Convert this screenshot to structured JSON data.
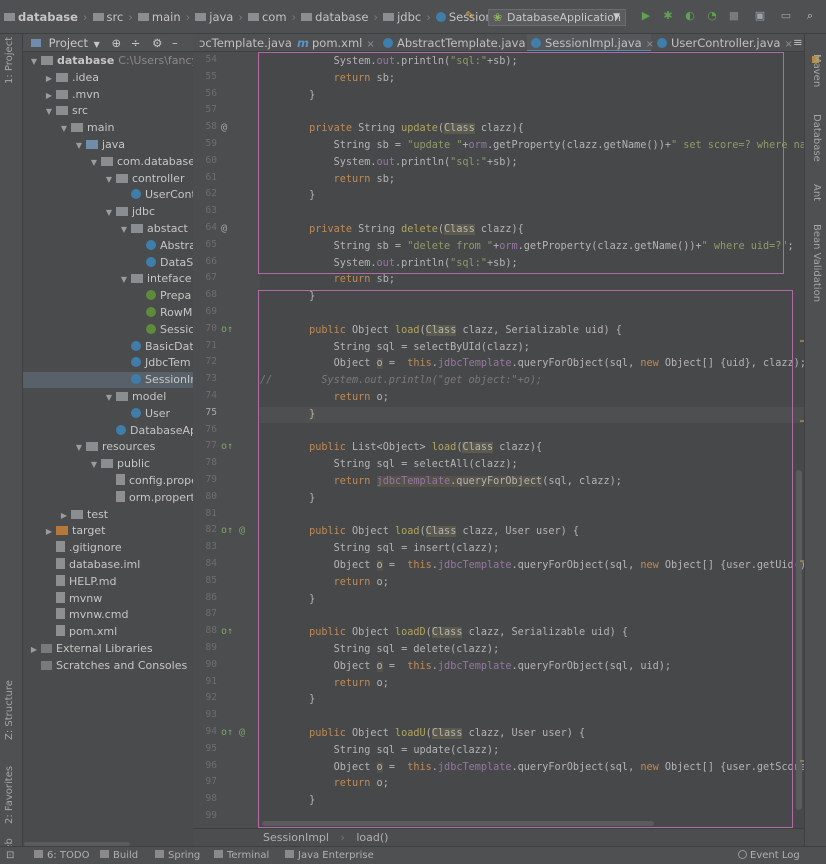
{
  "breadcrumb": [
    {
      "label": "database",
      "icon": "folder-icon"
    },
    {
      "label": "src",
      "icon": "folder-icon"
    },
    {
      "label": "main",
      "icon": "folder-icon"
    },
    {
      "label": "java",
      "icon": "folder-icon"
    },
    {
      "label": "com",
      "icon": "folder-icon"
    },
    {
      "label": "database",
      "icon": "folder-icon"
    },
    {
      "label": "jdbc",
      "icon": "folder-icon"
    },
    {
      "label": "SessionImpl",
      "icon": "class-icon"
    }
  ],
  "run_config": {
    "label": "DatabaseApplication"
  },
  "project_panel": {
    "title": "Project"
  },
  "tree": [
    {
      "label": "database",
      "detail": "C:\\Users\\fancy55\\",
      "depth": 0,
      "arrow": "▼",
      "icon": "folder",
      "bold": true
    },
    {
      "label": ".idea",
      "depth": 1,
      "arrow": "▶",
      "icon": "folder"
    },
    {
      "label": ".mvn",
      "depth": 1,
      "arrow": "▶",
      "icon": "folder"
    },
    {
      "label": "src",
      "depth": 1,
      "arrow": "▼",
      "icon": "folder"
    },
    {
      "label": "main",
      "depth": 2,
      "arrow": "▼",
      "icon": "folder"
    },
    {
      "label": "java",
      "depth": 3,
      "arrow": "▼",
      "icon": "folder-blue"
    },
    {
      "label": "com.database",
      "depth": 4,
      "arrow": "▼",
      "icon": "folder"
    },
    {
      "label": "controller",
      "depth": 5,
      "arrow": "▼",
      "icon": "folder"
    },
    {
      "label": "UserCont",
      "depth": 6,
      "arrow": "",
      "icon": "class"
    },
    {
      "label": "jdbc",
      "depth": 5,
      "arrow": "▼",
      "icon": "folder"
    },
    {
      "label": "abstact",
      "depth": 6,
      "arrow": "▼",
      "icon": "folder"
    },
    {
      "label": "Abstra",
      "depth": 7,
      "arrow": "",
      "icon": "class"
    },
    {
      "label": "DataS",
      "depth": 7,
      "arrow": "",
      "icon": "class"
    },
    {
      "label": "inteface",
      "depth": 6,
      "arrow": "▼",
      "icon": "folder"
    },
    {
      "label": "Prepa",
      "depth": 7,
      "arrow": "",
      "icon": "iface"
    },
    {
      "label": "RowM",
      "depth": 7,
      "arrow": "",
      "icon": "iface"
    },
    {
      "label": "Sessic",
      "depth": 7,
      "arrow": "",
      "icon": "iface"
    },
    {
      "label": "BasicData",
      "depth": 6,
      "arrow": "",
      "icon": "class"
    },
    {
      "label": "JdbcTem",
      "depth": 6,
      "arrow": "",
      "icon": "class"
    },
    {
      "label": "SessionIr",
      "depth": 6,
      "arrow": "",
      "icon": "class",
      "selected": true
    },
    {
      "label": "model",
      "depth": 5,
      "arrow": "▼",
      "icon": "folder"
    },
    {
      "label": "User",
      "depth": 6,
      "arrow": "",
      "icon": "class"
    },
    {
      "label": "DatabaseAp",
      "depth": 5,
      "arrow": "",
      "icon": "class"
    },
    {
      "label": "resources",
      "depth": 3,
      "arrow": "▼",
      "icon": "folder"
    },
    {
      "label": "public",
      "depth": 4,
      "arrow": "▼",
      "icon": "folder"
    },
    {
      "label": "config.prope",
      "depth": 5,
      "arrow": "",
      "icon": "file"
    },
    {
      "label": "orm.propert",
      "depth": 5,
      "arrow": "",
      "icon": "file"
    },
    {
      "label": "test",
      "depth": 2,
      "arrow": "▶",
      "icon": "folder"
    },
    {
      "label": "target",
      "depth": 1,
      "arrow": "▶",
      "icon": "folder-orange"
    },
    {
      "label": ".gitignore",
      "depth": 1,
      "arrow": "",
      "icon": "file"
    },
    {
      "label": "database.iml",
      "depth": 1,
      "arrow": "",
      "icon": "file"
    },
    {
      "label": "HELP.md",
      "depth": 1,
      "arrow": "",
      "icon": "file"
    },
    {
      "label": "mvnw",
      "depth": 1,
      "arrow": "",
      "icon": "file"
    },
    {
      "label": "mvnw.cmd",
      "depth": 1,
      "arrow": "",
      "icon": "file"
    },
    {
      "label": "pom.xml",
      "depth": 1,
      "arrow": "",
      "icon": "file"
    },
    {
      "label": "External Libraries",
      "depth": 0,
      "arrow": "▶",
      "icon": "lib"
    },
    {
      "label": "Scratches and Consoles",
      "depth": 0,
      "arrow": "",
      "icon": "lib"
    }
  ],
  "tabs": [
    {
      "label": "ɔcTemplate.java",
      "icon": "class",
      "active": false
    },
    {
      "label": "pom.xml",
      "icon": "maven",
      "active": false
    },
    {
      "label": "AbstractTemplate.java",
      "icon": "class",
      "active": false
    },
    {
      "label": "SessionImpl.java",
      "icon": "class",
      "active": true
    },
    {
      "label": "UserController.java",
      "icon": "class",
      "active": false
    }
  ],
  "code": [
    {
      "n": "54",
      "h": "            System.<f>out</f>.println(<s>\"sql:\"</s>+sb);"
    },
    {
      "n": "55",
      "h": "            <k>return</k> sb;"
    },
    {
      "n": "56",
      "h": "        }"
    },
    {
      "n": "57",
      "h": ""
    },
    {
      "n": "58",
      "mark": "@",
      "h": "        <k>private</k> String <y>update</y>(<cls>Class</cls> clazz){"
    },
    {
      "n": "59",
      "h": "            String sb = <s>\"update \"</s>+<f>orm</f>.getProperty(clazz.getName())+<s>\" set score=? where name=?\"</s>;"
    },
    {
      "n": "60",
      "h": "            System.<f>out</f>.println(<s>\"sql:\"</s>+sb);"
    },
    {
      "n": "61",
      "h": "            <k>return</k> sb;"
    },
    {
      "n": "62",
      "h": "        }"
    },
    {
      "n": "63",
      "h": ""
    },
    {
      "n": "64",
      "mark": "@",
      "h": "        <k>private</k> String <y>delete</y>(<cls>Class</cls> clazz){"
    },
    {
      "n": "65",
      "h": "            String sb = <s>\"delete from \"</s>+<f>orm</f>.getProperty(clazz.getName())+<s>\" where uid=?\"</s>;"
    },
    {
      "n": "66",
      "h": "            System.<f>out</f>.println(<s>\"sql:\"</s>+sb);"
    },
    {
      "n": "67",
      "h": "            <k>return</k> sb;"
    },
    {
      "n": "68",
      "h": "        }"
    },
    {
      "n": "69",
      "h": ""
    },
    {
      "n": "70",
      "mark": "o↑",
      "h": "        <k>public</k> Object <y>load</y>(<cls>Class</cls> clazz, Serializable uid) {"
    },
    {
      "n": "71",
      "h": "            String sql = selectByUId(clazz);"
    },
    {
      "n": "72",
      "h": "            Object <sb>o</sb> =  <k>this</k>.<f>jdbcTemplate</f>.queryForObject(sql, <k>new</k> Object[] {uid}, clazz);"
    },
    {
      "n": "73",
      "h": "<c>//        System.out.println(\"get object:\"+o);</c>"
    },
    {
      "n": "74",
      "h": "            <k>return</k> o;"
    },
    {
      "n": "75",
      "cur": true,
      "h": "        <sb>}</sb>"
    },
    {
      "n": "76",
      "h": ""
    },
    {
      "n": "77",
      "mark": "o↑",
      "h": "        <k>public</k> List&lt;Object&gt; <y>load</y>(<cls>Class</cls> clazz){"
    },
    {
      "n": "78",
      "h": "            String sql = selectAll(clazz);"
    },
    {
      "n": "79",
      "h": "            <k>return</k> <sb><f>jdbcTemplate</f></sb><sb>.queryForObject</sb>(sql, clazz);"
    },
    {
      "n": "80",
      "h": "        }"
    },
    {
      "n": "81",
      "h": ""
    },
    {
      "n": "82",
      "mark": "o↑ @",
      "h": "        <k>public</k> Object <y>load</y>(<cls>Class</cls> clazz, User user) {"
    },
    {
      "n": "83",
      "h": "            String sql = insert(clazz);"
    },
    {
      "n": "84",
      "h": "            Object <sb>o</sb> =  <k>this</k>.<f>jdbcTemplate</f>.queryForObject(sql, <k>new</k> Object[] {user.getUid(),user.ge"
    },
    {
      "n": "85",
      "h": "            <k>return</k> o;"
    },
    {
      "n": "86",
      "h": "        }"
    },
    {
      "n": "87",
      "h": ""
    },
    {
      "n": "88",
      "mark": "o↑",
      "h": "        <k>public</k> Object <y>loadD</y>(<cls>Class</cls> clazz, Serializable uid) {"
    },
    {
      "n": "89",
      "h": "            String sql = delete(clazz);"
    },
    {
      "n": "90",
      "h": "            Object <sb>o</sb> =  <k>this</k>.<f>jdbcTemplate</f>.queryForObject(sql, uid);"
    },
    {
      "n": "91",
      "h": "            <k>return</k> o;"
    },
    {
      "n": "92",
      "h": "        }"
    },
    {
      "n": "93",
      "h": ""
    },
    {
      "n": "94",
      "mark": "o↑ @",
      "h": "        <k>public</k> Object <y>loadU</y>(<cls>Class</cls> clazz, User user) {"
    },
    {
      "n": "95",
      "h": "            String sql = update(clazz);"
    },
    {
      "n": "96",
      "h": "            Object <sb>o</sb> =  <k>this</k>.<f>jdbcTemplate</f>.queryForObject(sql, <k>new</k> Object[] {user.getScore(), user"
    },
    {
      "n": "97",
      "h": "            <k>return</k> o;"
    },
    {
      "n": "98",
      "h": "        }"
    },
    {
      "n": "99",
      "h": ""
    }
  ],
  "editor_breadcrumb": {
    "class_name": "SessionImpl",
    "separator": "›",
    "method": "load()"
  },
  "left_strip": {
    "project": "1: Project",
    "structure": "Z: Structure",
    "favorites": "2: Favorites",
    "web": "Web"
  },
  "right_strip": {
    "maven": "Maven",
    "database": "Database",
    "ant": "Ant",
    "bean": "Bean Validation"
  },
  "status_bar": [
    {
      "label": "6: TODO"
    },
    {
      "label": "Build"
    },
    {
      "label": "Spring"
    },
    {
      "label": "Terminal"
    },
    {
      "label": "Java Enterprise"
    }
  ],
  "event_log": {
    "label": "Event Log"
  },
  "colors": {
    "highlight_box": "#b06aa6",
    "background": "#4a4b4c"
  }
}
